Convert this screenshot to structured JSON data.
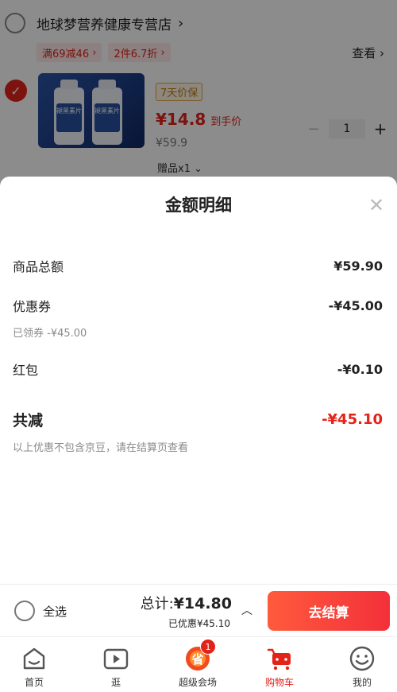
{
  "background_cart": {
    "shop_name": "地球梦营养健康专营店",
    "promo_tags": [
      "满69减46",
      "2件6.7折"
    ],
    "view_link": "查看",
    "product": {
      "bottle_label": "褪黑素片",
      "guarantee": "7天价保",
      "price": "¥14.8",
      "price_note": "到手价",
      "original_price": "¥59.9",
      "gift": "赠品x1",
      "quantity": "1"
    }
  },
  "sheet": {
    "title": "金额明细",
    "close_icon": "close-icon",
    "goods_total": {
      "label": "商品总额",
      "value": "¥59.90"
    },
    "coupon": {
      "label": "优惠券",
      "value": "-¥45.00",
      "sub": "已领券 -¥45.00"
    },
    "red_packet": {
      "label": "红包",
      "value": "-¥0.10"
    },
    "total_discount": {
      "label": "共减",
      "value": "-¥45.10",
      "note": "以上优惠不包含京豆，请在结算页查看"
    }
  },
  "checkout": {
    "select_all": "全选",
    "total_label": "总计:",
    "total_amount": "¥14.80",
    "saved": "已优惠¥45.10",
    "button": "去结算"
  },
  "tabbar": {
    "items": [
      {
        "label": "首页",
        "icon": "home-icon"
      },
      {
        "label": "逛",
        "icon": "video-icon"
      },
      {
        "label": "超级会场",
        "icon": "super-venue-icon",
        "badge": "1"
      },
      {
        "label": "购物车",
        "icon": "cart-icon"
      },
      {
        "label": "我的",
        "icon": "profile-icon"
      }
    ]
  },
  "colors": {
    "accent": "#e2231a",
    "button_gradient_start": "#ff5a3c",
    "button_gradient_end": "#f3303a"
  }
}
